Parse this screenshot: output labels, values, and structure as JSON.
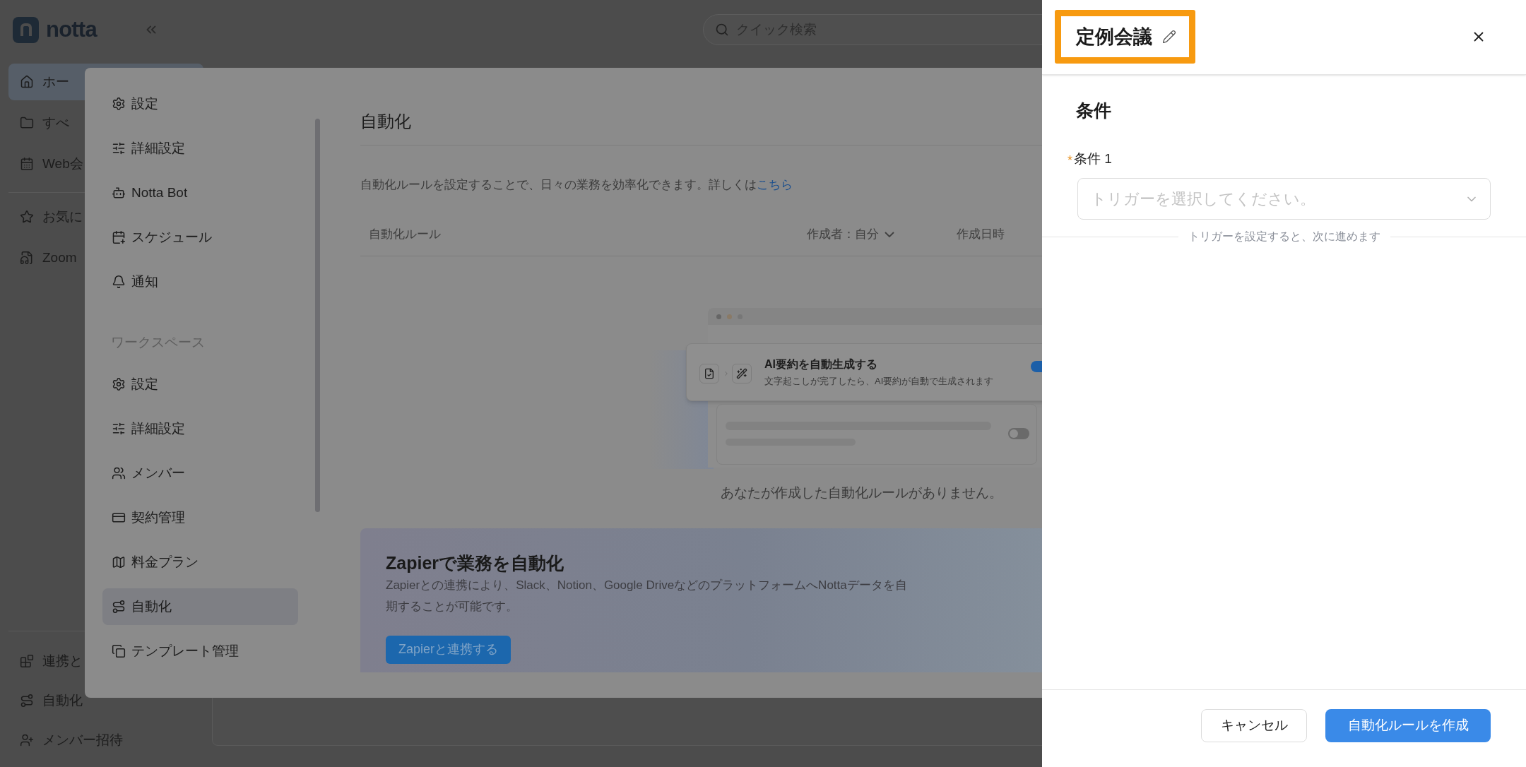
{
  "app": {
    "logo_text": "notta",
    "search": {
      "placeholder": "クイック検索"
    },
    "sidebar": {
      "items": [
        {
          "label": "ホー",
          "selected": true
        },
        {
          "label": "すべ",
          "selected": false
        },
        {
          "label": "Web会",
          "selected": false
        },
        {
          "label": "お気に",
          "selected": false
        },
        {
          "label": "Zoom",
          "selected": false
        }
      ],
      "bottom_items": [
        {
          "label": "連携と"
        },
        {
          "label": "自動化"
        },
        {
          "label": "メンバー招待"
        }
      ]
    }
  },
  "settings_modal": {
    "nav": {
      "groups": [
        {
          "items": [
            {
              "label": "設定",
              "selected": false
            },
            {
              "label": "詳細設定",
              "selected": false
            },
            {
              "label": "Notta Bot",
              "selected": false
            },
            {
              "label": "スケジュール",
              "selected": false
            },
            {
              "label": "通知",
              "selected": false
            }
          ]
        },
        {
          "title": "ワークスペース",
          "items": [
            {
              "label": "設定",
              "selected": false
            },
            {
              "label": "詳細設定",
              "selected": false
            },
            {
              "label": "メンバー",
              "selected": false
            },
            {
              "label": "契約管理",
              "selected": false
            },
            {
              "label": "料金プラン",
              "selected": false
            },
            {
              "label": "自動化",
              "selected": true
            },
            {
              "label": "テンプレート管理",
              "selected": false
            }
          ]
        }
      ]
    },
    "title": "自動化",
    "description": "自動化ルールを設定することで、日々の業務を効率化できます。詳しくは",
    "description_link": "こちら",
    "table": {
      "columns": [
        "自動化ルール",
        "作成者：自分",
        "作成日時"
      ]
    },
    "illustration": {
      "rules": [
        {
          "kind": "filled",
          "title": "AI要約を自動生成する",
          "subtitle": "文字起こしが完了したら、AI要約が自動で生成されます",
          "on": true
        },
        {
          "kind": "skeleton",
          "on": false
        }
      ]
    },
    "empty_message": "あなたが作成した自動化ルールがありません。",
    "zapier": {
      "title": "Zapierで業務を自動化",
      "lines": [
        "Zapierとの連携により、Slack、Notion、Google DriveなどのプラットフォームへNottaデータを自",
        "期することが可能です。"
      ],
      "button": "Zapierと連携する"
    }
  },
  "drawer": {
    "title": "定例会議",
    "section": "条件",
    "condition": {
      "label": "条件 1",
      "required_mark": "*",
      "placeholder": "トリガーを選択してください。"
    },
    "hint": "トリガーを設定すると、次に進めます",
    "buttons": [
      {
        "kind": "secondary",
        "label": "キャンセル"
      },
      {
        "kind": "primary",
        "label": "自動化ルールを作成"
      }
    ]
  }
}
